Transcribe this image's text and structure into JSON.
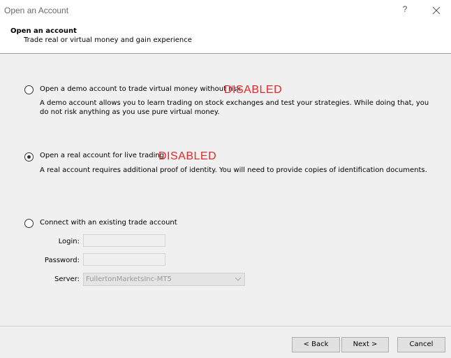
{
  "window": {
    "title": "Open an Account",
    "help_label": "?"
  },
  "header": {
    "title": "Open an account",
    "subtitle": "Trade real or virtual money and gain experience"
  },
  "options": {
    "demo": {
      "label": "Open a demo account to trade virtual money without risk",
      "tag": "DISABLED",
      "description": "A demo account allows you to learn trading on stock exchanges and test your strategies. While doing that, you do not risk anything as you use pure virtual money.",
      "checked": false
    },
    "real": {
      "label": "Open a real account for live trading",
      "tag": "DISABLED",
      "description": "A real account requires additional proof of identity. You will need to provide copies of identification documents.",
      "checked": true
    },
    "existing": {
      "label": "Connect with an existing trade account",
      "checked": false,
      "login_label": "Login:",
      "login_value": "",
      "password_label": "Password:",
      "password_value": "",
      "server_label": "Server:",
      "server_value": "FullertonMarketsInc-MT5"
    }
  },
  "footer": {
    "back_label": "< Back",
    "next_label": "Next >",
    "cancel_label": "Cancel"
  },
  "colors": {
    "disabled_tag": "#e8262a",
    "accent": "#0078d7"
  }
}
